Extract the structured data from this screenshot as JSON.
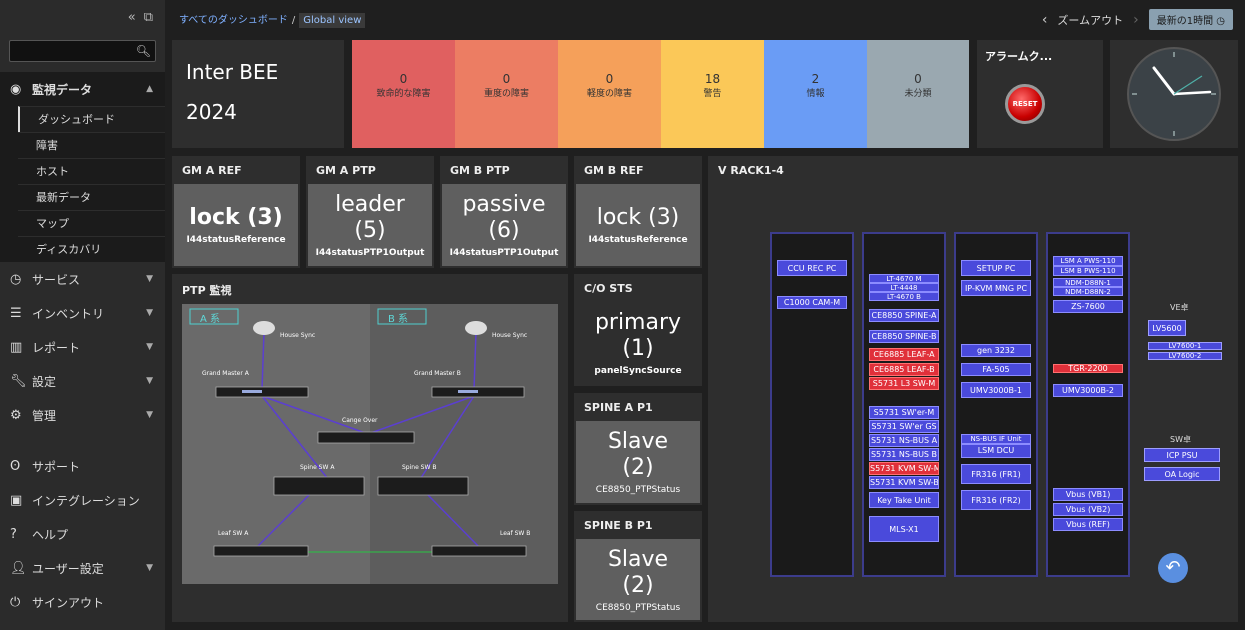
{
  "sidebar": {
    "collapse_icon": "double-chevron-left",
    "menu": [
      {
        "label": "監視データ",
        "icon": "eye"
      },
      {
        "label": "サービス",
        "icon": "clock"
      },
      {
        "label": "インベントリ",
        "icon": "list"
      },
      {
        "label": "レポート",
        "icon": "bar-chart"
      },
      {
        "label": "設定",
        "icon": "wrench"
      },
      {
        "label": "管理",
        "icon": "gear"
      }
    ],
    "submenu": [
      "ダッシュボード",
      "障害",
      "ホスト",
      "最新データ",
      "マップ",
      "ディスカバリ"
    ],
    "lower": [
      {
        "label": "サポート",
        "icon": "support"
      },
      {
        "label": "インテグレーション",
        "icon": "integration"
      },
      {
        "label": "ヘルプ",
        "icon": "help"
      },
      {
        "label": "ユーザー設定",
        "icon": "user"
      },
      {
        "label": "サインアウト",
        "icon": "power"
      }
    ]
  },
  "topbar": {
    "breadcrumb_root": "すべてのダッシュボード",
    "breadcrumb_sep": "/",
    "breadcrumb_current": "Global view",
    "zoom_out": "ズームアウト",
    "time_range": "最新の1時間"
  },
  "title_panel": {
    "line1": "Inter BEE",
    "line2": "2024"
  },
  "severity": [
    {
      "count": "0",
      "label": "致命的な障害",
      "color": "#e06060"
    },
    {
      "count": "0",
      "label": "重度の障害",
      "color": "#ec7d63"
    },
    {
      "count": "0",
      "label": "軽度の障害",
      "color": "#f5a05a"
    },
    {
      "count": "18",
      "label": "警告",
      "color": "#fbc858"
    },
    {
      "count": "2",
      "label": "情報",
      "color": "#6a9cf5"
    },
    {
      "count": "0",
      "label": "未分類",
      "color": "#9aa8b0"
    }
  ],
  "alarm": {
    "title": "アラームク...",
    "reset": "RESET"
  },
  "status_panels": [
    {
      "title": "GM A REF",
      "value": "lock (3)",
      "item": "I44statusReference"
    },
    {
      "title": "GM A PTP",
      "value": "leader (5)",
      "item": "I44statusPTP1Output"
    },
    {
      "title": "GM B PTP",
      "value": "passive (6)",
      "item": "I44statusPTP1Output"
    },
    {
      "title": "GM B REF",
      "value": "lock (3)",
      "item": "I44statusReference"
    }
  ],
  "co_sts": {
    "title": "C/O STS",
    "value": "primary (1)",
    "item": "panelSyncSource"
  },
  "spine_a": {
    "title": "SPINE A P1",
    "value": "Slave (2)",
    "item": "CE8850_PTPStatus"
  },
  "spine_b": {
    "title": "SPINE B P1",
    "value": "Slave (2)",
    "item": "CE8850_PTPStatus"
  },
  "ptp": {
    "title": "PTP 監視",
    "sys_a": "A 系",
    "sys_b": "B 系",
    "house_sync": "House Sync",
    "gm_a": "Grand Master A",
    "gm_b": "Grand Master B",
    "change_over": "Cange Over",
    "spine_a": "Spine SW A",
    "spine_b": "Spine SW B",
    "leaf_a": "Leaf SW A",
    "leaf_b": "Leaf SW B"
  },
  "vrack": {
    "title": "V RACK1-4",
    "rack1": [
      {
        "label": "CCU REC PC",
        "red": false
      },
      {
        "label": "C1000 CAM-M",
        "red": false
      }
    ],
    "rack2": [
      {
        "label": "LT-4670 M",
        "red": false
      },
      {
        "label": "LT-4448",
        "red": false
      },
      {
        "label": "LT-4670 B",
        "red": false
      },
      {
        "label": "CE8850 SPINE-A",
        "red": false
      },
      {
        "label": "CE8850 SPINE-B",
        "red": false
      },
      {
        "label": "CE6885 LEAF-A",
        "red": true
      },
      {
        "label": "CE6885 LEAF-B",
        "red": true
      },
      {
        "label": "S5731 L3 SW-M",
        "red": true
      },
      {
        "label": "S5731 SW'er-M",
        "red": false
      },
      {
        "label": "S5731 SW'er GS",
        "red": false
      },
      {
        "label": "S5731 NS-BUS A",
        "red": false
      },
      {
        "label": "S5731 NS-BUS B",
        "red": false
      },
      {
        "label": "S5731 KVM SW-M",
        "red": true
      },
      {
        "label": "S5731 KVM SW-B",
        "red": false
      },
      {
        "label": "Key Take Unit",
        "red": false
      },
      {
        "label": "MLS-X1",
        "red": false
      }
    ],
    "rack3": [
      {
        "label": "SETUP PC",
        "red": false
      },
      {
        "label": "IP-KVM MNG PC",
        "red": false
      },
      {
        "label": "gen 3232",
        "red": false
      },
      {
        "label": "FA-505",
        "red": false
      },
      {
        "label": "UMV3000B-1",
        "red": false
      },
      {
        "label": "NS-BUS IF Unit",
        "red": false
      },
      {
        "label": "LSM DCU",
        "red": false
      },
      {
        "label": "FR316 (FR1)",
        "red": false
      },
      {
        "label": "FR316 (FR2)",
        "red": false
      }
    ],
    "rack4": [
      {
        "label": "LSM A PWS-110",
        "red": false
      },
      {
        "label": "LSM B PWS-110",
        "red": false
      },
      {
        "label": "NDM-D88N-1",
        "red": false
      },
      {
        "label": "NDM-D88N-2",
        "red": false
      },
      {
        "label": "ZS-7600",
        "red": false
      },
      {
        "label": "TGR-2200",
        "red": true
      },
      {
        "label": "UMV3000B-2",
        "red": false
      },
      {
        "label": "Vbus (VB1)",
        "red": false
      },
      {
        "label": "Vbus (VB2)",
        "red": false
      },
      {
        "label": "Vbus (REF)",
        "red": false
      }
    ],
    "ve_title": "VE卓",
    "ve_items": [
      "LV5600",
      "LV7600-1",
      "LV7600-2"
    ],
    "sw_title": "SW卓",
    "sw_items": [
      "ICP PSU",
      "OA Logic"
    ]
  }
}
